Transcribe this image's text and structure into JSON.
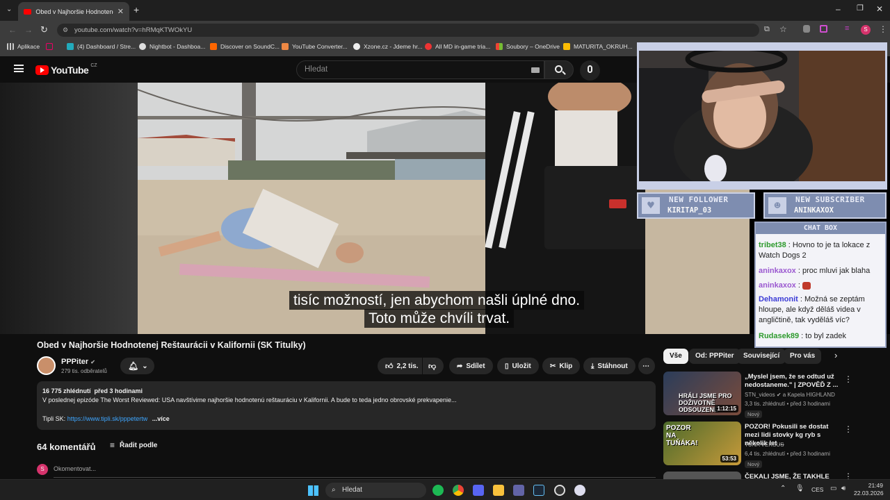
{
  "browser": {
    "tab_title": "Obed v Najhoršie Hodnotenej R",
    "url": "youtube.com/watch?v=hRMqKTWOkYU",
    "bookmarks": [
      "Aplikace",
      "(4) Dashboard / Stre...",
      "Nightbot - Dashboa...",
      "Discover on SoundC...",
      "YouTube Converter...",
      "Xzone.cz - Jdeme hr...",
      "All MD in-game tria...",
      "Soubory – OneDrive",
      "MATURITA_OKRUH..."
    ],
    "profile_initial": "S"
  },
  "youtube": {
    "logo": "YouTube",
    "region": "CZ",
    "search_placeholder": "Hledat"
  },
  "video": {
    "captions": [
      "tisíc možností, jen abychom našli úplné dno.",
      "Toto může chvíli trvat."
    ],
    "title": "Obed v Najhoršie Hodnotenej Reštaurácii v Kalifornii (SK Titulky)",
    "channel": "PPPiter",
    "subscribers": "279 tis. odběratelů",
    "likes": "2,2 tis.",
    "actions": {
      "share": "Sdílet",
      "save": "Uložit",
      "clip": "Klip",
      "download": "Stáhnout"
    },
    "views_line": "16 775 zhlédnutí  před 3 hodinami",
    "description": "V poslednej epizóde The Worst Reviewed: USA navštívime najhoršie hodnotenú reštauráciu v Kalifornii. A bude to teda jedno obrovské prekvapenie...",
    "tipli_label": "Tipli SK:",
    "tipli_link": "https://www.tipli.sk/pppetertw",
    "more": "...více",
    "comments_count": "64 komentářů",
    "sort_label": "Řadit podle",
    "comment_placeholder": "Okomentovat..."
  },
  "filters": [
    "Vše",
    "Od: PPPiter",
    "Související",
    "Pro vás"
  ],
  "recommendations": [
    {
      "title": "„Myslel jsem, že se odtud už nedostaneme.\" | ZPOVĚĎ Z ...",
      "channel": "STN_videos",
      "collab": "a Kapela HIGHLAND",
      "meta": "3,3 tis. zhlédnutí • před 3 hodinami",
      "badge": "Nový",
      "duration": "1:12:15",
      "thumb_text": "HRÁLI JSME PRO DOŽIVOTNĚ ODSOUZENÉ"
    },
    {
      "title": "POZOR! Pokusili se dostat mezi lidi stovky kg ryb s několik let ...",
      "channel": "TUNA VERSUS",
      "collab": "",
      "meta": "6,4 tis. zhlédnutí • před 3 hodinami",
      "badge": "Nový",
      "duration": "53:53",
      "thumb_text": "POZOR NA TUŇÁKA!"
    },
    {
      "title": "ČEKALI JSME, ŽE TAKHLE",
      "channel": "",
      "collab": "",
      "meta": "",
      "badge": "",
      "duration": "",
      "thumb_text": ""
    }
  ],
  "stream": {
    "new_follower_title": "NEW FOLLOWER",
    "new_follower_value": "KIRITAP_03",
    "new_subscriber_title": "NEW SUBSCRIBER",
    "new_subscriber_value": "ANINKAXOX",
    "chat_title": "CHAT BOX",
    "chat": [
      {
        "user": "tribet38",
        "text": " : Hovno to je ta lokace z Watch Dogs 2",
        "color": "#2d9a2d"
      },
      {
        "user": "aninkaxox",
        "text": " : proc mluvi jak blaha",
        "color": "#9b59d0"
      },
      {
        "user": "aninkaxox",
        "text": " :",
        "color": "#9b59d0"
      },
      {
        "user": "Dehamonit",
        "text": " : Možná se zeptám hloupe, ale když děláš videa v angličtině, tak vyděláš víc?",
        "color": "#3b3bd6"
      },
      {
        "user": "Rudasek89",
        "text": " : to byl zadek",
        "color": "#2d9a2d"
      }
    ]
  },
  "taskbar": {
    "search": "Hledat",
    "lang": "CES",
    "time": "21:49",
    "date": "22.03.2026"
  }
}
